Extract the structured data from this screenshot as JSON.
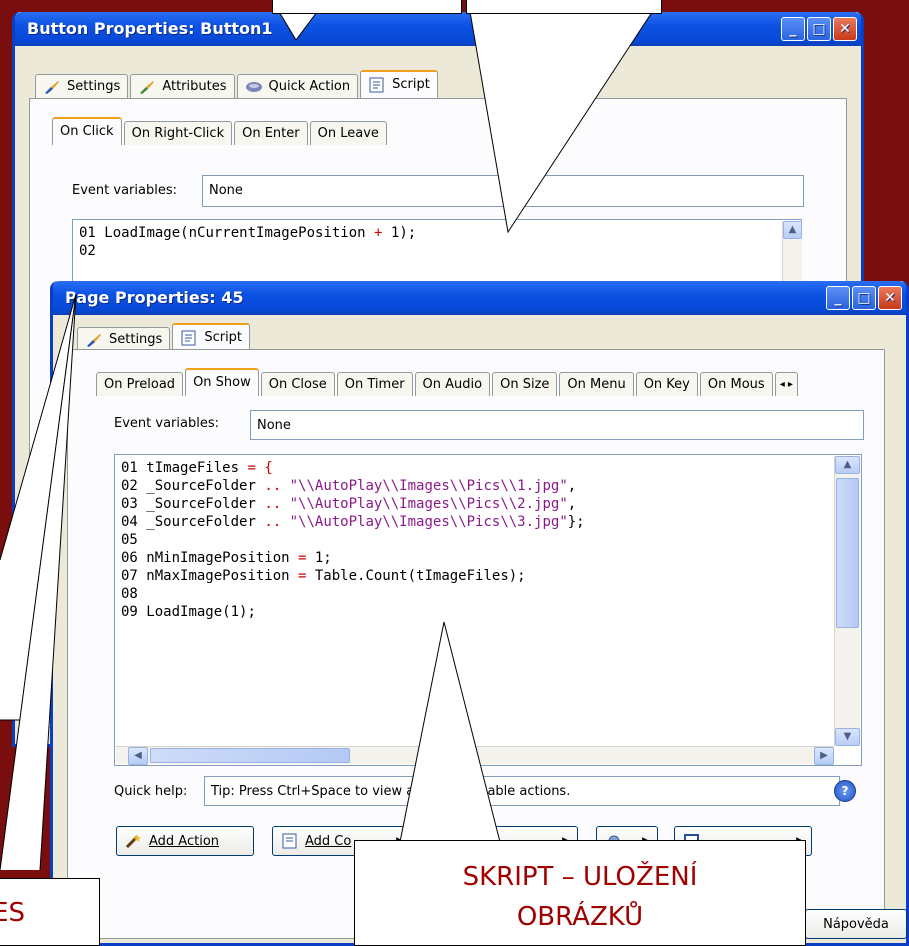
{
  "button_window": {
    "title": "Button Properties: Button1",
    "tabs": [
      "Settings",
      "Attributes",
      "Quick Action",
      "Script"
    ],
    "event_tabs": [
      "On Click",
      "On Right-Click",
      "On Enter",
      "On Leave"
    ],
    "event_variables_label": "Event variables:",
    "event_variables_value": "None",
    "code": {
      "line1_num": "01",
      "line1_func": "LoadImage(nCurrentImagePosition",
      "line1_op": "+",
      "line1_rest": "1);",
      "line2_num": "02"
    }
  },
  "page_window": {
    "title": "Page Properties: 45",
    "tabs": [
      "Settings",
      "Script"
    ],
    "event_tabs": [
      "On Preload",
      "On Show",
      "On Close",
      "On Timer",
      "On Audio",
      "On Size",
      "On Menu",
      "On Key",
      "On Mous"
    ],
    "event_variables_label": "Event variables:",
    "event_variables_value": "None",
    "code_lines": [
      {
        "n": "01",
        "a": "tImageFiles ",
        "op": "= {",
        "s": "",
        "e": ""
      },
      {
        "n": "02",
        "a": "_SourceFolder ",
        "op": "..",
        "s": " \"\\\\AutoPlay\\\\Images\\\\Pics\\\\1.jpg\"",
        "e": ","
      },
      {
        "n": "03",
        "a": "_SourceFolder ",
        "op": "..",
        "s": " \"\\\\AutoPlay\\\\Images\\\\Pics\\\\2.jpg\"",
        "e": ","
      },
      {
        "n": "04",
        "a": "_SourceFolder ",
        "op": "..",
        "s": " \"\\\\AutoPlay\\\\Images\\\\Pics\\\\3.jpg\"",
        "e": "};"
      },
      {
        "n": "05",
        "a": "",
        "op": "",
        "s": "",
        "e": ""
      },
      {
        "n": "06",
        "a": "nMinImagePosition ",
        "op": "=",
        "s": "",
        "e": " 1;"
      },
      {
        "n": "07",
        "a": "nMaxImagePosition ",
        "op": "=",
        "s": "",
        "e": " Table.Count(tImageFiles);"
      },
      {
        "n": "08",
        "a": "",
        "op": "",
        "s": "",
        "e": ""
      },
      {
        "n": "09",
        "a": "LoadImage(1);",
        "op": "",
        "s": "",
        "e": ""
      }
    ],
    "quick_help_label": "Quick help:",
    "quick_help_value": "Tip: Press Ctrl+Space to view a",
    "quick_help_tail": "ailable actions.",
    "buttons": {
      "add_action": "Add Action",
      "add_code": "Add Co",
      "help": "Nápověda"
    }
  },
  "callouts": {
    "script_storage_line1": "SKRIPT – ULOŽENÍ",
    "script_storage_line2": "OBRÁZKŮ",
    "left_partial": "ES"
  },
  "colors": {
    "background": "#7a0d0d",
    "title_bar": "#0c52e3",
    "callout_text": "#a00000",
    "code_operator": "#d00000",
    "code_string": "#8a1a8a"
  }
}
